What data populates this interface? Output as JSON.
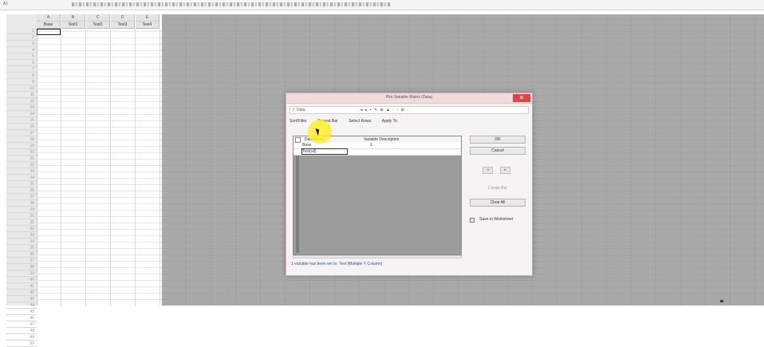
{
  "app": {
    "cell_reference": "A1"
  },
  "spreadsheet": {
    "column_headers": [
      {
        "letter": "A",
        "name": "Base"
      },
      {
        "letter": "B",
        "name": "Test1"
      },
      {
        "letter": "C",
        "name": "Test2"
      },
      {
        "letter": "D",
        "name": "Test3"
      },
      {
        "letter": "E",
        "name": "Test4"
      }
    ],
    "row_numbers": [
      "1",
      "2",
      "3",
      "4",
      "5",
      "6",
      "7",
      "8",
      "9",
      "10",
      "11",
      "12",
      "13",
      "14",
      "15",
      "16",
      "17",
      "18",
      "19",
      "20",
      "21",
      "22",
      "23",
      "24",
      "25",
      "26",
      "27",
      "28",
      "29",
      "30",
      "31",
      "32",
      "33",
      "34",
      "35",
      "36",
      "37",
      "38",
      "39",
      "40",
      "41",
      "42",
      "43",
      "44",
      "45",
      "46",
      "47",
      "48",
      "49",
      "50"
    ]
  },
  "dialog": {
    "title": "Plot Variable Matrix (Data)",
    "close_glyph": "✕",
    "address_label": "Data",
    "fx_glyph": "ƒ",
    "toolbar_glyphs": "◂ ▸ ▪ ✎ ⊕ ▲ ◦ ◦ ⊞ ◦",
    "menu": [
      "Sort/Filter",
      "Repeat Bar",
      "Select Rows",
      "Apply To"
    ],
    "list_headers": {
      "name": "Dataname",
      "desc": "Variable Description"
    },
    "list_rows": [
      {
        "name": "Base",
        "desc": "1"
      },
      {
        "name": "Test(all)",
        "desc": ""
      }
    ],
    "buttons": {
      "ok": "OK",
      "cancel": "Cancel",
      "create_bar": "Create Bar",
      "clear_all": "Clear All"
    },
    "arrow_left": "◂",
    "arrow_right": "▸",
    "option_label": "Save to Worksheet",
    "status_text": "1 variable has been set to: Test (Multiple Y Column)"
  }
}
